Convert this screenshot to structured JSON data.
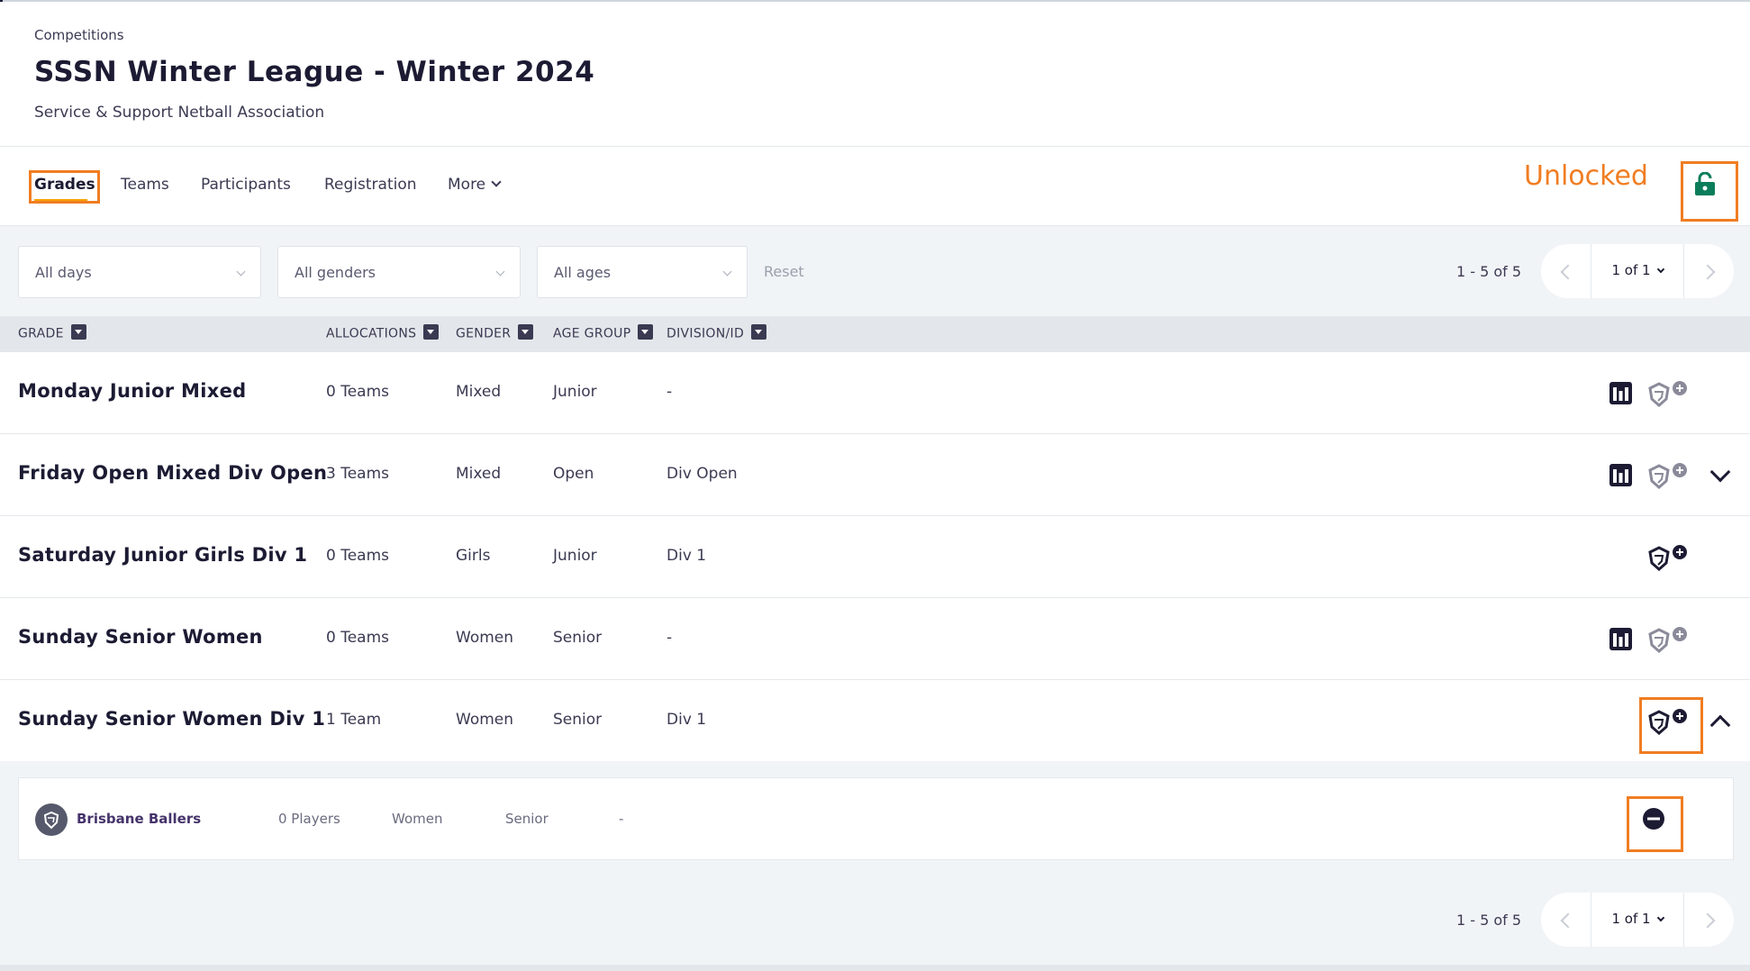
{
  "header": {
    "breadcrumb": "Competitions",
    "title": "SSSN Winter League - Winter 2024",
    "subtitle": "Service & Support Netball Association"
  },
  "tabs": [
    {
      "label": "Grades",
      "active": true
    },
    {
      "label": "Teams"
    },
    {
      "label": "Participants"
    },
    {
      "label": "Registration"
    },
    {
      "label": "More"
    }
  ],
  "lock_status": {
    "label": "Unlocked",
    "icon": "lock-open-icon",
    "color": "#0b7d5a"
  },
  "filters": {
    "days": "All days",
    "genders": "All genders",
    "ages": "All ages",
    "reset": "Reset"
  },
  "pagination": {
    "range": "1 - 5 of 5",
    "page": "1 of 1"
  },
  "columns": [
    "GRADE",
    "ALLOCATIONS",
    "GENDER",
    "AGE GROUP",
    "DIVISION/ID"
  ],
  "rows": [
    {
      "grade": "Monday Junior Mixed",
      "allocations": "0 Teams",
      "gender": "Mixed",
      "age_group": "Junior",
      "division": "-",
      "icons": [
        "bracket-icon",
        "shield-add-icon-inactive"
      ]
    },
    {
      "grade": "Friday Open Mixed Div Open",
      "allocations": "3 Teams",
      "gender": "Mixed",
      "age_group": "Open",
      "division": "Div Open",
      "icons": [
        "bracket-icon",
        "shield-add-icon-inactive",
        "chevron-down-icon"
      ]
    },
    {
      "grade": "Saturday Junior Girls Div 1",
      "allocations": "0 Teams",
      "gender": "Girls",
      "age_group": "Junior",
      "division": "Div 1",
      "icons": [
        "shield-add-icon"
      ]
    },
    {
      "grade": "Sunday Senior Women",
      "allocations": "0 Teams",
      "gender": "Women",
      "age_group": "Senior",
      "division": "-",
      "icons": [
        "bracket-icon",
        "shield-add-icon-inactive"
      ]
    },
    {
      "grade": "Sunday Senior Women Div 1",
      "allocations": "1 Team",
      "gender": "Women",
      "age_group": "Senior",
      "division": "Div 1",
      "icons": [
        "shield-add-icon",
        "chevron-up-icon"
      ]
    }
  ],
  "expanded_team": {
    "name": "Brisbane Ballers",
    "players": "0 Players",
    "gender": "Women",
    "age_group": "Senior",
    "division": "-",
    "action_icon": "remove-circle-icon"
  },
  "colors": {
    "highlight": "#f07d22",
    "accent_tab": "#f6a200",
    "lock_green": "#0b7d5a",
    "dark": "#1c1b33"
  }
}
